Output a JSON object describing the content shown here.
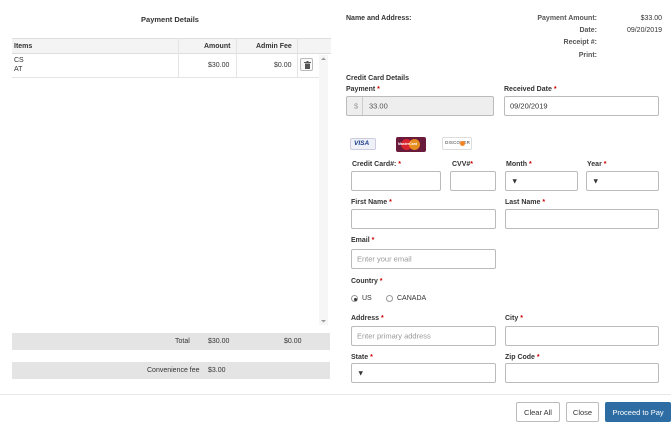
{
  "payment_details": {
    "title": "Payment Details",
    "columns": [
      "Items",
      "Amount",
      "Admin Fee"
    ],
    "rows": [
      {
        "item_line1": "CS",
        "item_line2": "AT",
        "amount": "$30.00",
        "admin_fee": "$0.00"
      }
    ],
    "total_label": "Total",
    "total_amount": "$30.00",
    "total_fee": "$0.00",
    "convenience_label": "Convenience fee",
    "convenience_amount": "$3.00"
  },
  "summary": {
    "name_address_label": "Name and Address:",
    "payment_amount_label": "Payment Amount:",
    "payment_amount_value": "$33.00",
    "date_label": "Date:",
    "date_value": "09/20/2019",
    "receipt_label": "Receipt #:",
    "print_label": "Print:"
  },
  "credit_card": {
    "section_title": "Credit Card Details",
    "payment_label": "Payment",
    "currency_symbol": "$",
    "payment_value": "33.00",
    "received_date_label": "Received Date",
    "received_date_value": "09/20/2019",
    "card_logos": [
      "VISA",
      "MasterCard",
      "DISCOVER"
    ],
    "card_number_label": "Credit Card#:",
    "cvv_label": "CVV#",
    "month_label": "Month",
    "year_label": "Year",
    "first_name_label": "First Name",
    "last_name_label": "Last Name",
    "email_label": "Email",
    "email_placeholder": "Enter your email",
    "country_label": "Country",
    "country_options": [
      "US",
      "CANADA"
    ],
    "country_selected": "US",
    "address_label": "Address",
    "address_placeholder": "Enter primary address",
    "city_label": "City",
    "state_label": "State",
    "zip_label": "Zip Code",
    "required_mark": "*"
  },
  "footer": {
    "clear_all": "Clear All",
    "close": "Close",
    "proceed": "Proceed to Pay"
  },
  "colors": {
    "primary": "#2e6da4",
    "required": "#cc0000",
    "bar_gray": "#e4e4e4"
  },
  "icons": [
    "trash-icon",
    "scroll-up-icon",
    "scroll-down-icon",
    "chevron-down-icon"
  ]
}
